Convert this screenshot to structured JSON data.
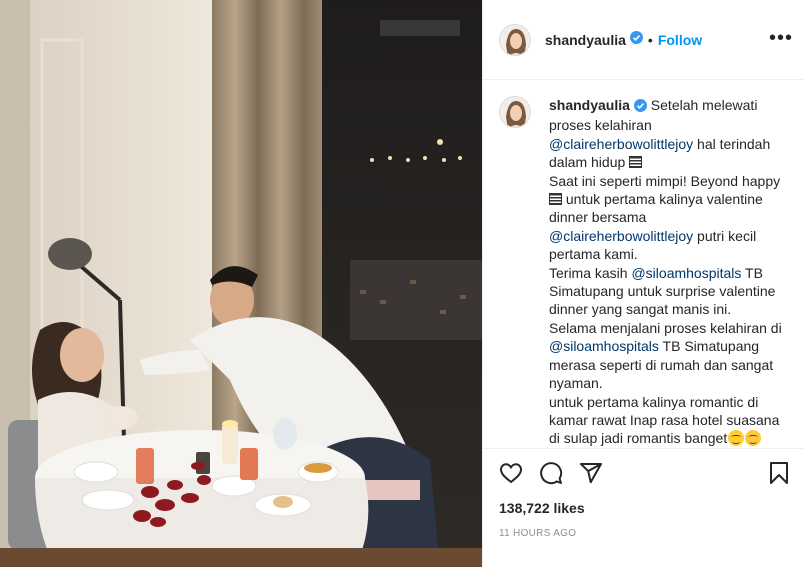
{
  "post": {
    "username": "shandyaulia",
    "follow_label": "Follow",
    "dot": "•",
    "more_label": "•••",
    "caption": {
      "username": "shandyaulia",
      "l1": " Setelah melewati",
      "l2": "proses kelahiran",
      "m1": "@claireherbowolittlejoy",
      "l3": " hal terindah",
      "l4": "dalam hidup ",
      "l5": "Saat ini seperti mimpi! Beyond happy",
      "l6": " untuk pertama kalinya valentine",
      "l7": "dinner bersama",
      "m2": "@claireherbowolittlejoy",
      "l8": " putri kecil",
      "l9": "pertama kami.",
      "l10": "Terima kasih ",
      "m3": "@siloamhospitals",
      "l11": " TB",
      "l12": "Simatupang untuk surprise valentine",
      "l13": "dinner yang sangat manis ini.",
      "l14": "Selama menjalani proses kelahiran di",
      "m4": "@siloamhospitals",
      "l15": " TB Simatupang",
      "l16": "merasa seperti di rumah dan sangat",
      "l17": "nyaman.",
      "l18": "untuk pertama kalinya romantic di",
      "l19": "kamar rawat Inap rasa hotel suasana",
      "l20": "di sulap jadi romantis banget"
    },
    "likes": "138,722 likes",
    "timestamp": "11 HOURS AGO"
  },
  "colors": {
    "follow": "#0095f6",
    "verified": "#3897f0",
    "mention": "#00376b",
    "muted": "#8e8e8e"
  },
  "icons": [
    "verified-badge-icon",
    "heart-icon",
    "comment-icon",
    "share-icon",
    "bookmark-icon",
    "more-options-icon"
  ]
}
